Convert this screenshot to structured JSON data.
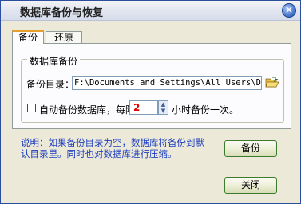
{
  "window": {
    "title": "数据库备份与恢复",
    "close_glyph": "×"
  },
  "tabs": [
    {
      "label": "备份",
      "active": true
    },
    {
      "label": "还原",
      "active": false
    }
  ],
  "backup": {
    "group_title": "数据库备份",
    "dir_label": "备份目录：",
    "dir_value": "F:\\Documents and Settings\\All Users\\Docume",
    "auto_label": "自动备份数据库，每隔",
    "interval_value": "2",
    "interval_suffix": "小时备份一次。",
    "auto_checked": false
  },
  "note": "说明：如果备份目录为空，数据库将备份到默认目录里。同时也对数据库进行压缩。",
  "buttons": {
    "backup": "备份",
    "close": "关闭"
  },
  "icons": {
    "close": "close-icon",
    "folder": "folder-open-icon",
    "spin_up": "spin-up-icon",
    "spin_down": "spin-down-icon"
  }
}
